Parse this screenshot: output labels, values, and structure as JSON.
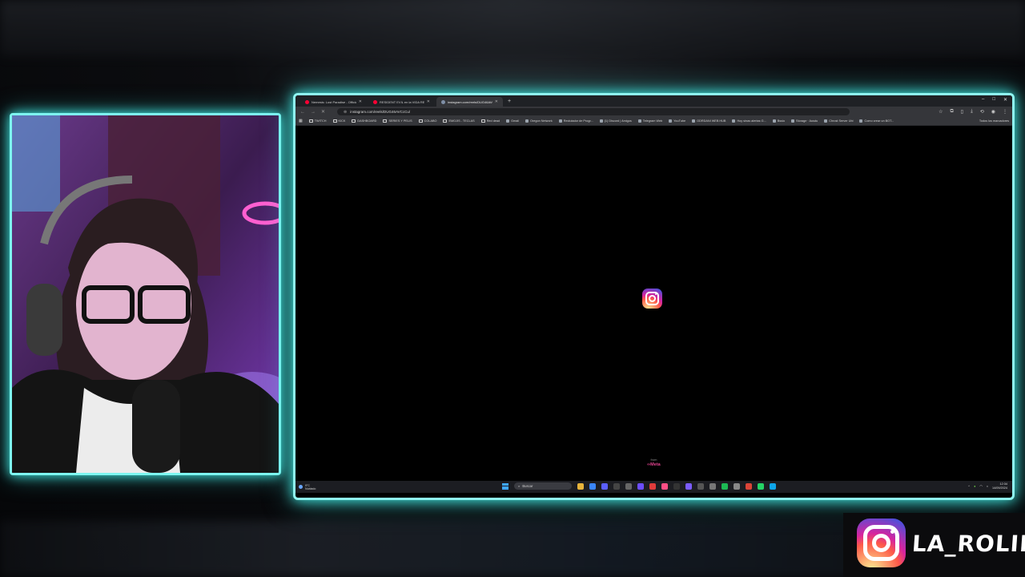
{
  "colors": {
    "frame_glow": "#41e8e2",
    "instagram_gradient": [
      "#fdf497",
      "#fd5949",
      "#d6249f",
      "#285AEB"
    ],
    "meta_pink": "#e2438f"
  },
  "browser": {
    "tabs": [
      {
        "title": "Nemesis: Lost Paradise - Officia",
        "favicon": "youtube-icon",
        "active": false
      },
      {
        "title": "RESIDENT EVIL en la VIDA REAL",
        "favicon": "youtube-icon",
        "active": false
      },
      {
        "title": "instagram.com/reels/DUG46AVCcCu/",
        "favicon": "globe-icon",
        "active": true
      }
    ],
    "new_tab": "+",
    "window_controls": [
      "–",
      "□",
      "✕"
    ],
    "address": {
      "url": "instagram.com/reels/DUG46AVCcCu/"
    },
    "bookmarks": [
      {
        "label": "TWITCH",
        "kind": "folder"
      },
      {
        "label": "KICK",
        "kind": "folder"
      },
      {
        "label": "DASHBOARD",
        "kind": "folder"
      },
      {
        "label": "SERIES Y PELIS",
        "kind": "folder"
      },
      {
        "label": "COLABO",
        "kind": "folder"
      },
      {
        "label": "EMOJIS - TECLAS",
        "kind": "folder"
      },
      {
        "label": "Red dead",
        "kind": "folder"
      },
      {
        "label": "Gmail",
        "kind": "site"
      },
      {
        "label": "Oregon Network",
        "kind": "site"
      },
      {
        "label": "Reclutador de Progr...",
        "kind": "site"
      },
      {
        "label": "(1) Discord | Amigos",
        "kind": "site"
      },
      {
        "label": "Telegram Web",
        "kind": "site"
      },
      {
        "label": "YouTube",
        "kind": "site"
      },
      {
        "label": "ODRDANI WEB HUB",
        "kind": "site"
      },
      {
        "label": "Hoy sinas alertas G...",
        "kind": "site"
      },
      {
        "label": "Bssio",
        "kind": "site"
      },
      {
        "label": "Storage · Ausdu",
        "kind": "site"
      },
      {
        "label": "Chrost Server Ubi",
        "kind": "site"
      },
      {
        "label": "Como crear un BOT...",
        "kind": "site"
      }
    ],
    "bookmarks_all": "Todos los marcadores",
    "page": {
      "from_label": "from",
      "meta_label": "∞Meta"
    }
  },
  "taskbar": {
    "weather": {
      "temp": "9°C",
      "condition": "Nublado"
    },
    "search_placeholder": "Buscar",
    "clock": {
      "time": "12:34",
      "date": "14/09/2024"
    }
  },
  "overlay": {
    "brand_name": "LA_ROLII"
  }
}
